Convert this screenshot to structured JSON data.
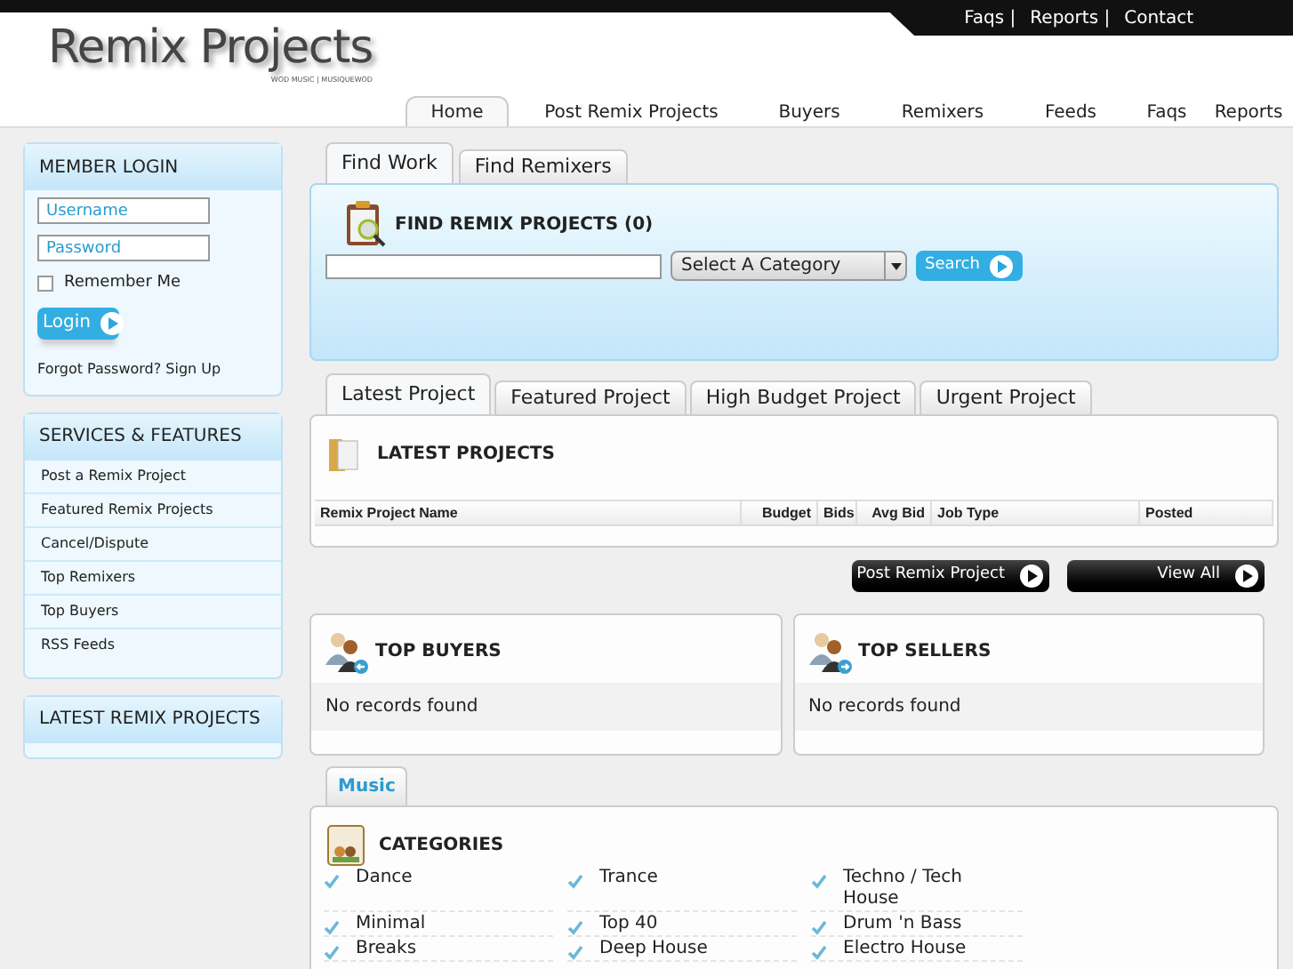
{
  "top_links": [
    "Faqs |",
    "Reports |",
    "Contact"
  ],
  "logo": {
    "title": "Remix Projects",
    "subtitle": "WOD MUSIC | MUSIQUEWOD"
  },
  "nav": [
    {
      "label": "Home",
      "selected": true
    },
    {
      "label": "Post Remix Projects",
      "selected": false
    },
    {
      "label": "Buyers",
      "selected": false
    },
    {
      "label": "Remixers",
      "selected": false
    },
    {
      "label": "Feeds",
      "selected": false
    },
    {
      "label": "Faqs",
      "selected": false
    },
    {
      "label": "Reports",
      "selected": false
    }
  ],
  "login": {
    "title": "MEMBER LOGIN",
    "username_placeholder": "Username",
    "password_placeholder": "Password",
    "remember": {
      "label": "Remember Me",
      "checked": false
    },
    "button": "Login",
    "links": "Forgot Password? Sign Up"
  },
  "services": {
    "title": "SERVICES & FEATURES",
    "items": [
      "Post a Remix Project",
      "Featured Remix Projects",
      "Cancel/Dispute",
      "Top Remixers",
      "Top Buyers",
      "RSS Feeds"
    ]
  },
  "latest_box": {
    "title": "LATEST REMIX PROJECTS"
  },
  "search_tabs": [
    {
      "label": "Find Work",
      "selected": true
    },
    {
      "label": "Find Remixers",
      "selected": false
    }
  ],
  "search": {
    "title": "FIND REMIX PROJECTS (0)",
    "category": "Select A Category",
    "button": "Search"
  },
  "project_tabs": [
    {
      "label": "Latest Project",
      "selected": true
    },
    {
      "label": "Featured Project",
      "selected": false
    },
    {
      "label": "High Budget Project",
      "selected": false
    },
    {
      "label": "Urgent Project",
      "selected": false
    }
  ],
  "projects": {
    "title": "LATEST PROJECTS",
    "columns": [
      "Remix Project Name",
      "Budget",
      "Bids",
      "Avg Bid",
      "Job Type",
      "Posted"
    ]
  },
  "actions": [
    "Post Remix Project",
    "View All"
  ],
  "top_buyers": {
    "title": "TOP BUYERS",
    "empty": "No records found"
  },
  "top_sellers": {
    "title": "TOP SELLERS",
    "empty": "No records found"
  },
  "category_tabs": [
    {
      "label": "Music",
      "selected": true
    }
  ],
  "categories": {
    "title": "CATEGORIES",
    "items": [
      "Dance",
      "Trance",
      "Techno / Tech House",
      "Minimal",
      "Top 40",
      "Drum 'n Bass",
      "Breaks",
      "Deep House",
      "Electro House"
    ]
  }
}
